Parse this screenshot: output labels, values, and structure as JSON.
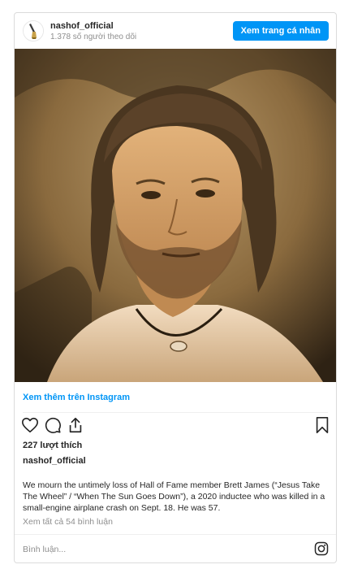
{
  "header": {
    "username": "nashof_official",
    "followers": "1.378 số người theo dõi",
    "view_profile_label": "Xem trang cá nhân"
  },
  "post": {
    "more_on_instagram": "Xem thêm trên Instagram",
    "likes": "227 lượt thích",
    "caption_user": "nashof_official",
    "caption": "We mourn the untimely loss of Hall of Fame member Brett James (“Jesus Take The Wheel” / “When The Sun Goes Down”), a 2020 inductee who was killed in a small-engine airplane crash on Sept. 18. He was 57.",
    "view_comments": "Xem tất cả 54 bình luận"
  },
  "comment": {
    "placeholder": "Bình luận..."
  },
  "icons": [
    "heart-icon",
    "comment-icon",
    "share-icon",
    "bookmark-icon",
    "instagram-icon"
  ],
  "colors": {
    "accent": "#0095f6",
    "text": "#262626",
    "muted": "#8e8e8e",
    "border": "#dbdbdb"
  }
}
